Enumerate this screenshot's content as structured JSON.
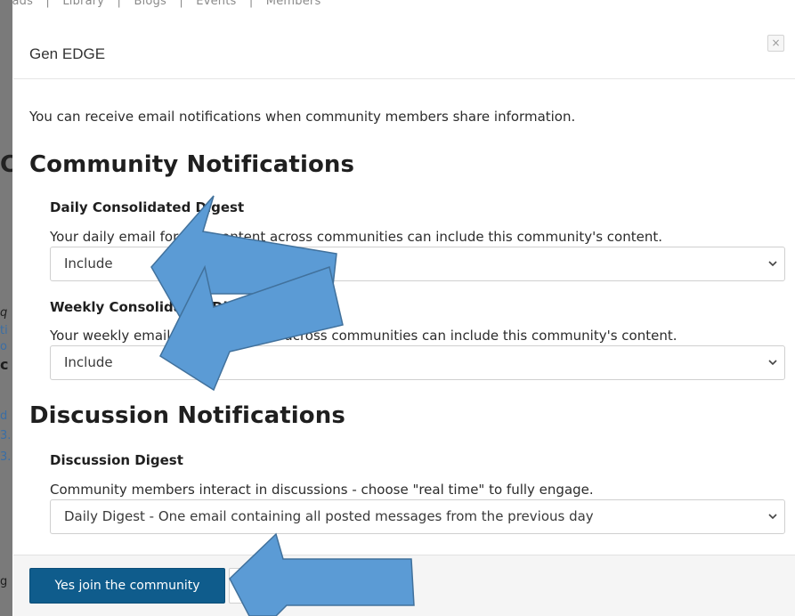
{
  "background": {
    "nav_items": [
      "reads",
      "Library",
      "Blogs",
      "Events",
      "Members"
    ],
    "left_fragments": [
      "C",
      "q",
      "ti",
      "o",
      "c",
      "d",
      "3.",
      "3.",
      "g"
    ]
  },
  "modal": {
    "title": "Gen EDGE",
    "close_label": "×",
    "intro": "You can receive email notifications when community members share information.",
    "community_heading": "Community Notifications",
    "daily": {
      "label": "Daily Consolidated Digest",
      "help": "Your daily email for new content across communities can include this community's content.",
      "value": "Include"
    },
    "weekly": {
      "label": "Weekly Consolidated Digest",
      "help": "Your weekly email for new content across communities can include this community's content.",
      "value": "Include"
    },
    "discussion_heading": "Discussion Notifications",
    "discussion": {
      "label": "Discussion Digest",
      "help": "Community members interact in discussions - choose \"real time\" to fully engage.",
      "value": "Daily Digest - One email containing all posted messages from the previous day"
    },
    "footer": {
      "primary_label": "Yes join the community"
    }
  },
  "colors": {
    "primary_button": "#0f5c8c",
    "arrow_fill": "#5b9bd5",
    "arrow_stroke": "#41719c"
  }
}
